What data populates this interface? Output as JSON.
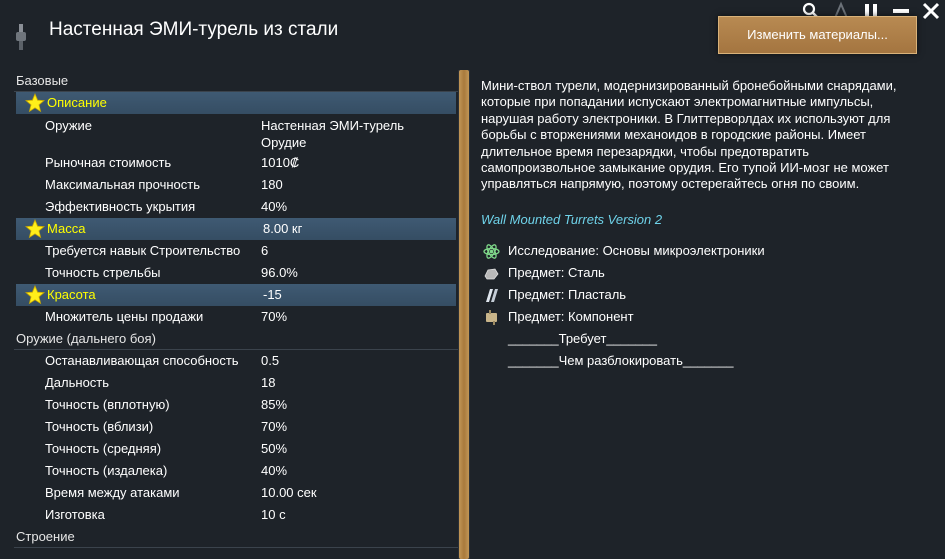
{
  "window": {
    "title": "Настенная ЭМИ-турель из стали",
    "change_materials_button": "Изменить материалы..."
  },
  "stats": {
    "sections": [
      {
        "header": "Базовые",
        "rows": [
          {
            "label": "Описание",
            "value": "",
            "highlight": true
          },
          {
            "label": "Оружие",
            "value": "Настенная ЭМИ-турель\nОрудие"
          },
          {
            "label": "Рыночная стоимость",
            "value": "1010₡"
          },
          {
            "label": "Максимальная прочность",
            "value": "180"
          },
          {
            "label": "Эффективность укрытия",
            "value": "40%"
          },
          {
            "label": "Масса",
            "value": "8.00 кг",
            "highlight": true
          },
          {
            "label": "Требуется навык Строительство",
            "value": "6"
          },
          {
            "label": "Точность стрельбы",
            "value": "96.0%"
          },
          {
            "label": "Красота",
            "value": "-15",
            "highlight": true
          },
          {
            "label": "Множитель цены продажи",
            "value": "70%"
          }
        ]
      },
      {
        "header": "Оружие (дальнего боя)",
        "rows": [
          {
            "label": "Останавливающая способность",
            "value": "0.5"
          },
          {
            "label": "Дальность",
            "value": "18"
          },
          {
            "label": "Точность (вплотную)",
            "value": "85%"
          },
          {
            "label": "Точность (вблизи)",
            "value": "70%"
          },
          {
            "label": "Точность (средняя)",
            "value": "50%"
          },
          {
            "label": "Точность (издалека)",
            "value": "40%"
          },
          {
            "label": "Время между атаками",
            "value": "10.00 сек"
          },
          {
            "label": "Изготовка",
            "value": "10 с"
          }
        ]
      },
      {
        "header": "Строение",
        "rows": []
      }
    ]
  },
  "description": {
    "text": "Мини-ствол турели, модернизированный бронебойными снарядами, которые при попадании испускают электромагнитные импульсы, нарушая работу электроники. В Глиттерворлдах их используют для борьбы с вторжениями механоидов в городские районы. Имеет длительное время перезарядки, чтобы предотвратить самопроизвольное замыкание орудия. Его тупой ИИ-мозг не может управляться напрямую, поэтому остерегайтесь огня по своим.",
    "mod_name": "Wall Mounted Turrets Version 2",
    "requirements": [
      {
        "icon": "research-icon",
        "text": "Исследование: Основы микроэлектроники"
      },
      {
        "icon": "steel-icon",
        "text": "Предмет: Сталь"
      },
      {
        "icon": "plasteel-icon",
        "text": "Предмет: Пласталь"
      },
      {
        "icon": "component-icon",
        "text": "Предмет: Компонент"
      }
    ],
    "required_by": "_______Требует_______",
    "unlocks": "_______Чем разблокировать_______"
  },
  "colors": {
    "background": "#1e2329",
    "highlight_row": "#3f5a73",
    "highlight_label": "#ffff00",
    "button": "#a97a3c",
    "mod_name": "#6fd3ea"
  }
}
